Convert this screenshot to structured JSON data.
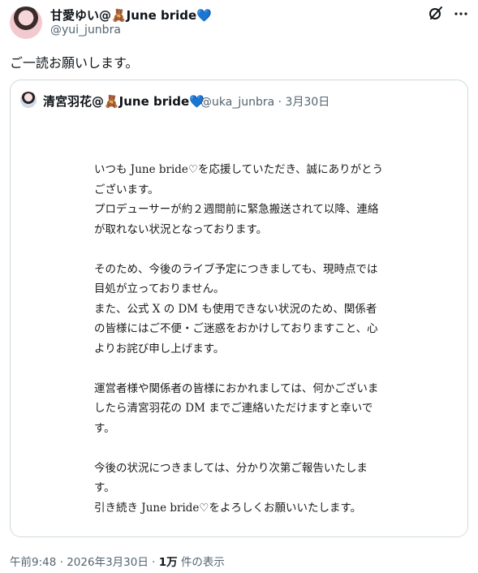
{
  "post": {
    "author_name": "甘愛ゆい@🧸June bride💙",
    "author_handle": "@yui_junbra",
    "text": "ご一読お願いします。"
  },
  "quoted_post": {
    "author_name": "清宮羽花@🧸June bride💙",
    "author_handle": "@uka_junbra",
    "separator": "·",
    "date": "3月30日",
    "letter_lines": [
      "いつも June bride♡を応援していただき、誠にありがとう",
      "ございます。",
      "プロデューサーが約２週間前に緊急搬送されて以降、連絡",
      "が取れない状況となっております。",
      "",
      "そのため、今後のライブ予定につきましても、現時点では",
      "目処が立っておりません。",
      "また、公式 X の DM も使用できない状況のため、関係者",
      "の皆様にはご不便・ご迷惑をおかけしておりますこと、心",
      "よりお詫び申し上げます。",
      "",
      "運営者様や関係者の皆様におかれましては、何かございま",
      "したら清宮羽花の DM までご連絡いただけますと幸いで",
      "す。",
      "",
      "今後の状況につきましては、分かり次第ご報告いたしま",
      "す。",
      "引き続き June bride♡をよろしくお願いいたします。"
    ]
  },
  "footer": {
    "time": "午前9:48",
    "separator": "·",
    "date": "2026年3月30日",
    "views_count": "1万",
    "views_label": "件の表示"
  },
  "icons": {
    "grok": "grok-icon",
    "more": "more-options-icon"
  }
}
